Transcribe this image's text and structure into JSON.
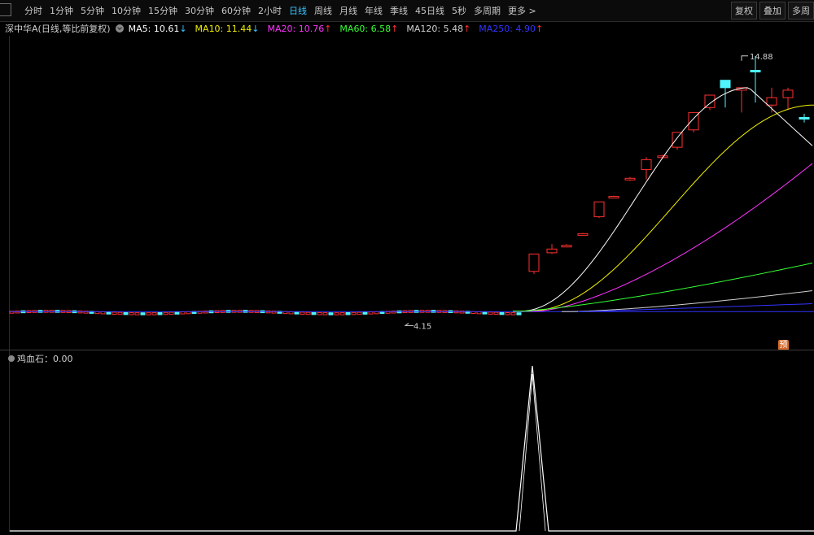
{
  "toolbar": {
    "periods": [
      "分时",
      "1分钟",
      "5分钟",
      "10分钟",
      "15分钟",
      "30分钟",
      "60分钟",
      "2小时",
      "日线",
      "周线",
      "月线",
      "年线",
      "季线",
      "45日线",
      "5秒",
      "多周期",
      "更多 >"
    ],
    "active_period": "日线",
    "right_buttons": {
      "restore": "复权",
      "overlay": "叠加",
      "multi": "多周"
    }
  },
  "legend": {
    "title": "深中华A(日线,等比前复权)",
    "ma": [
      {
        "label": "MA5: 10.61",
        "arrow": "↓",
        "color": "#ffffff",
        "arrow_color": "#39c3ff"
      },
      {
        "label": "MA10: 11.44",
        "arrow": "↓",
        "color": "#f0f000",
        "arrow_color": "#39c3ff"
      },
      {
        "label": "MA20: 10.76",
        "arrow": "↑",
        "color": "#ff33ff",
        "arrow_color": "#ff3030"
      },
      {
        "label": "MA60: 6.58",
        "arrow": "↑",
        "color": "#33ff33",
        "arrow_color": "#ff3030"
      },
      {
        "label": "MA120: 5.48",
        "arrow": "↑",
        "color": "#d0d0d0",
        "arrow_color": "#ff3030"
      },
      {
        "label": "MA250: 4.90",
        "arrow": "↑",
        "color": "#3333ff",
        "arrow_color": "#ff3030"
      }
    ]
  },
  "price_markers": {
    "high": "14.88",
    "low": "4.15"
  },
  "badge": "预",
  "sub_indicator": {
    "label": "鸡血石：0.00"
  },
  "colors": {
    "up": "#ff3030",
    "down": "#4ff5ff",
    "ma5": "#ffffff",
    "ma10": "#f0f000",
    "ma20": "#ff33ff",
    "ma60": "#33ff33",
    "ma120": "#d0d0d0",
    "ma250": "#3333ff"
  },
  "chart_data": {
    "type": "line",
    "price_range": [
      4.15,
      14.88
    ],
    "candles": [
      {
        "o": 6.2,
        "h": 6.45,
        "c": 6.9,
        "l": 6.1,
        "up": true
      },
      {
        "o": 6.95,
        "h": 7.3,
        "c": 7.1,
        "l": 6.9,
        "up": true
      },
      {
        "o": 7.2,
        "h": 7.3,
        "c": 7.25,
        "l": 7.18,
        "up": true
      },
      {
        "o": 7.7,
        "h": 7.75,
        "c": 7.72,
        "l": 7.68,
        "up": true
      },
      {
        "o": 8.4,
        "h": 8.5,
        "c": 9.0,
        "l": 8.35,
        "up": true
      },
      {
        "o": 9.2,
        "h": 9.25,
        "c": 9.22,
        "l": 9.18,
        "up": true
      },
      {
        "o": 9.9,
        "h": 10.0,
        "c": 9.95,
        "l": 9.85,
        "up": true
      },
      {
        "o": 10.3,
        "h": 10.8,
        "c": 10.7,
        "l": 9.9,
        "up": true
      },
      {
        "o": 10.8,
        "h": 10.9,
        "c": 10.85,
        "l": 10.75,
        "up": true
      },
      {
        "o": 11.2,
        "h": 11.3,
        "c": 11.8,
        "l": 11.1,
        "up": true
      },
      {
        "o": 11.9,
        "h": 12.2,
        "c": 12.6,
        "l": 11.8,
        "up": true
      },
      {
        "o": 12.8,
        "h": 13.2,
        "c": 13.3,
        "l": 12.7,
        "up": true
      },
      {
        "o": 13.6,
        "h": 13.9,
        "c": 13.9,
        "l": 12.8,
        "down": true
      },
      {
        "o": 13.5,
        "h": 13.6,
        "c": 13.6,
        "l": 12.6,
        "up": true
      },
      {
        "o": 14.3,
        "h": 14.88,
        "c": 14.3,
        "l": 13.0,
        "down": true
      },
      {
        "o": 12.9,
        "h": 13.6,
        "c": 13.2,
        "l": 12.6,
        "up": true
      },
      {
        "o": 13.2,
        "h": 13.6,
        "c": 13.5,
        "l": 12.7,
        "up": true
      },
      {
        "o": 12.4,
        "h": 12.55,
        "c": 12.4,
        "l": 12.2,
        "down": true
      },
      {
        "o": 12.1,
        "h": 12.5,
        "c": 11.6,
        "l": 11.6,
        "up": true
      },
      {
        "o": 11.8,
        "h": 12.1,
        "c": 11.0,
        "l": 10.9,
        "down": true
      }
    ],
    "sub_values": [
      0,
      1,
      0
    ]
  }
}
